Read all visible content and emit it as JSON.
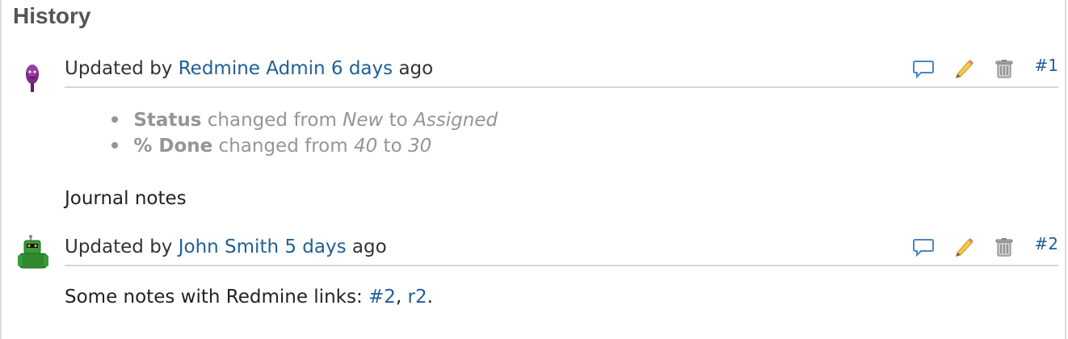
{
  "history": {
    "title": "History",
    "journals": [
      {
        "updated_prefix": "Updated by",
        "author": "Redmine Admin",
        "age": "6 days",
        "age_suffix": "ago",
        "number": "#1",
        "details": [
          {
            "field": "Status",
            "changed": "changed from",
            "from": "New",
            "to_word": "to",
            "to": "Assigned"
          },
          {
            "field": "% Done",
            "changed": "changed from",
            "from": "40",
            "to_word": "to",
            "to": "30"
          }
        ],
        "notes": "Journal notes"
      },
      {
        "updated_prefix": "Updated by",
        "author": "John Smith",
        "age": "5 days",
        "age_suffix": "ago",
        "number": "#2",
        "notes_prefix": "Some notes with Redmine links:",
        "notes_link1": "#2",
        "notes_sep": ",",
        "notes_link2": "r2",
        "notes_end": "."
      }
    ]
  },
  "icons": [
    "quote-icon",
    "edit-icon",
    "delete-icon"
  ],
  "colors": {
    "link": "#1f5f96",
    "muted": "#959595",
    "separator": "#d6d6d6"
  }
}
